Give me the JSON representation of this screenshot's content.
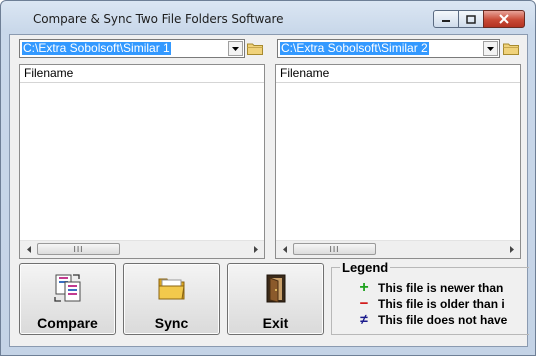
{
  "window": {
    "title": "Compare & Sync Two File Folders Software"
  },
  "left": {
    "path": "C:\\Extra Sobolsoft\\Similar 1",
    "column_header": "Filename",
    "scroll_grip": "III"
  },
  "right": {
    "path": "C:\\Extra Sobolsoft\\Similar 2",
    "column_header": "Filename",
    "scroll_grip": "III"
  },
  "buttons": {
    "compare": "Compare",
    "sync": "Sync",
    "exit": "Exit"
  },
  "legend": {
    "title": "Legend",
    "items": [
      {
        "symbol": "+",
        "text": "This file is newer than",
        "color": "#1da21d"
      },
      {
        "symbol": "−",
        "text": "This file is older than i",
        "color": "#d01010"
      },
      {
        "symbol": "≠",
        "text": "This file does not have",
        "color": "#1a1a8c"
      }
    ]
  },
  "colors": {
    "selection": "#3399ff",
    "close_button": "#c94a36",
    "client_background": "#f0f0f0"
  }
}
